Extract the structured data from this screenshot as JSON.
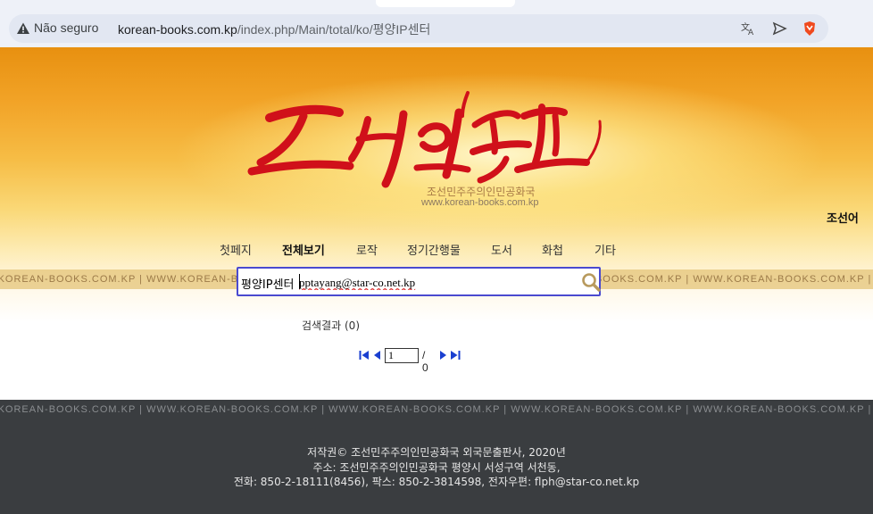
{
  "browser": {
    "security_label": "Não seguro",
    "url_host": "korean-books.com.kp",
    "url_path": "/index.php/Main/total/ko/평양IP센터",
    "icons": [
      "warning-icon",
      "translate-icon",
      "share-icon",
      "brave-shield-icon"
    ]
  },
  "site": {
    "logo_text": "조선의 출판물",
    "subtitle": "조선민주주의인민공화국",
    "site_url": "www.korean-books.com.kp",
    "language_link": "조선어"
  },
  "nav": {
    "items": [
      {
        "label": "첫페지",
        "active": false
      },
      {
        "label": "전체보기",
        "active": true
      },
      {
        "label": "로작",
        "active": false
      },
      {
        "label": "정기간행물",
        "active": false
      },
      {
        "label": "도서",
        "active": false
      },
      {
        "label": "화첩",
        "active": false
      },
      {
        "label": "기타",
        "active": false
      }
    ]
  },
  "stripe_text": "WWW.KOREAN-BOOKS.COM.KP",
  "search": {
    "prefix": "평양IP센터",
    "value": "pptayang@star-co.net.kp",
    "button_icon": "search-icon"
  },
  "results": {
    "label": "검색결과",
    "count": "(0)"
  },
  "pager": {
    "current_page": "1",
    "total": "/ 0"
  },
  "footer": {
    "line1": "저작권© 조선민주주의인민공화국 외국문출판사, 2020년",
    "line2": "주소: 조선민주주의인민공화국 평양시 서성구역 서천동,",
    "line3": "전화: 850-2-18111(8456), 팍스: 850-2-3814598, 전자우편: flph@star-co.net.kp"
  },
  "colors": {
    "logo_red": "#d0101a",
    "search_border": "#4a4ad0",
    "footer_bg": "#3a3d40",
    "pager_blue": "#1a3fd0"
  }
}
